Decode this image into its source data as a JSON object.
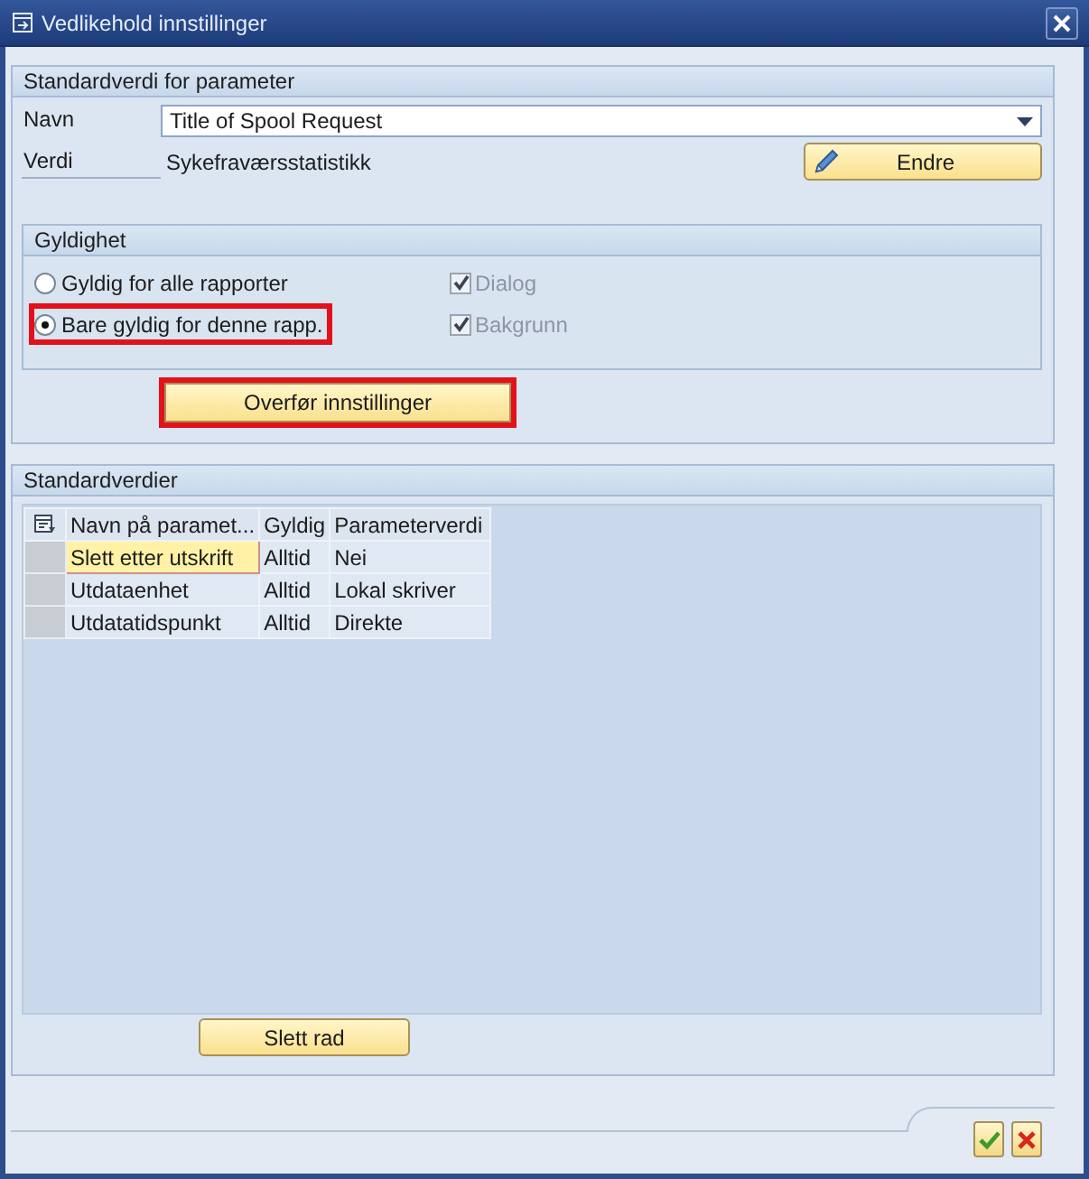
{
  "window": {
    "title": "Vedlikehold innstillinger"
  },
  "parameter_group": {
    "title": "Standardverdi for parameter",
    "name_label": "Navn",
    "name_value": "Title of Spool Request",
    "value_label": "Verdi",
    "value": "Sykefraværsstatistikk",
    "edit_button": "Endre",
    "validity": {
      "title": "Gyldighet",
      "options": [
        {
          "label": "Gyldig for alle rapporter",
          "selected": false,
          "highlighted": false
        },
        {
          "label": "Bare gyldig for denne rapp.",
          "selected": true,
          "highlighted": true
        }
      ],
      "checkboxes": [
        {
          "label": "Dialog",
          "checked": true,
          "disabled": true
        },
        {
          "label": "Bakgrunn",
          "checked": true,
          "disabled": true
        }
      ]
    },
    "transfer_button": {
      "label": "Overfør innstillinger",
      "highlighted": true
    }
  },
  "defaults_group": {
    "title": "Standardverdier",
    "table": {
      "columns": [
        "Navn på paramet...",
        "Gyldig",
        "Parameterverdi"
      ],
      "rows": [
        {
          "cells": [
            {
              "text": "Slett etter utskrift",
              "focused": true
            },
            {
              "text": "Alltid",
              "focused": false
            },
            {
              "text": "Nei",
              "focused": false
            }
          ]
        },
        {
          "cells": [
            {
              "text": "Utdataenhet",
              "focused": false
            },
            {
              "text": "Alltid",
              "focused": false
            },
            {
              "text": "Lokal skriver",
              "focused": false
            }
          ]
        },
        {
          "cells": [
            {
              "text": "Utdatatidspunkt",
              "focused": false
            },
            {
              "text": "Alltid",
              "focused": false
            },
            {
              "text": "Direkte",
              "focused": false
            }
          ]
        }
      ]
    },
    "delete_button": "Slett rad"
  }
}
